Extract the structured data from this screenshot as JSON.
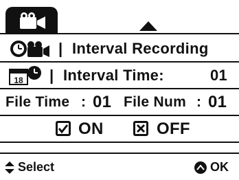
{
  "rows": {
    "mode_sep": "|",
    "mode_label": "Interval Recording",
    "time_sep": "|",
    "time_label": "Interval Time:",
    "time_value": "01",
    "file_time_label": "File Time",
    "file_time_value": "01",
    "file_num_label": "File Num",
    "file_num_value": "01",
    "colon": ":",
    "on_label": "ON",
    "off_label": "OFF"
  },
  "footer": {
    "select_label": "Select",
    "ok_label": "OK"
  },
  "icons": {
    "tab": "video-camera-icon",
    "mode": "timer-camera-icon",
    "time": "calendar-clock-icon",
    "calendar_day": "18",
    "on": "checked-box-icon",
    "off": "x-box-icon",
    "select": "up-down-arrows-icon",
    "ok": "ok-button-icon"
  },
  "colors": {
    "foreground": "#111111",
    "background": "#ffffff"
  }
}
